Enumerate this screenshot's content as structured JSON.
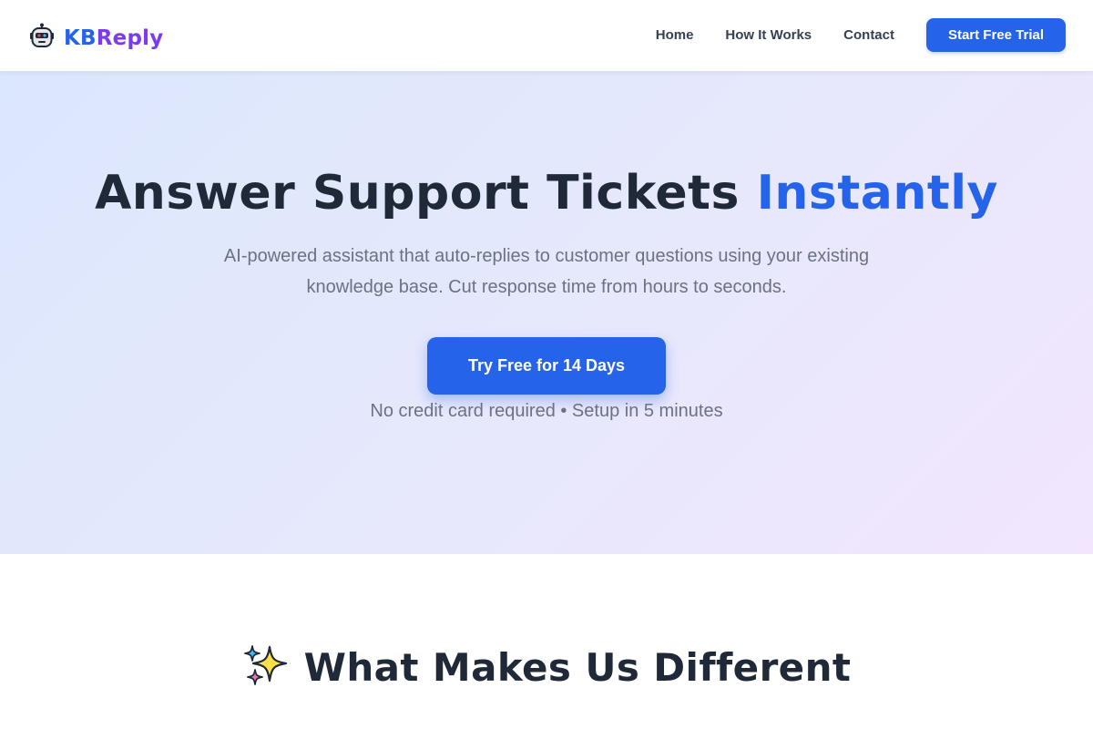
{
  "nav": {
    "brand_prefix": "KB",
    "brand_suffix": "Reply",
    "brand_icon": "robot-icon",
    "links": [
      "Home",
      "How It Works",
      "Contact"
    ],
    "cta": "Start Free Trial"
  },
  "hero": {
    "title_main": "Answer Support Tickets ",
    "title_accent": "Instantly",
    "subtitle_line1": "AI-powered assistant that auto-replies to customer questions using your existing",
    "subtitle_line2": "knowledge base. Cut response time from hours to seconds.",
    "cta": "Try Free for 14 Days",
    "note": "No credit card required • Setup in 5 minutes"
  },
  "features": {
    "icon": "sparkles-icon",
    "title": "What Makes Us Different"
  },
  "colors": {
    "primary": "#2563eb",
    "secondary": "#7c3aed",
    "text_dark": "#1f2937",
    "text_muted": "#6b7280"
  }
}
